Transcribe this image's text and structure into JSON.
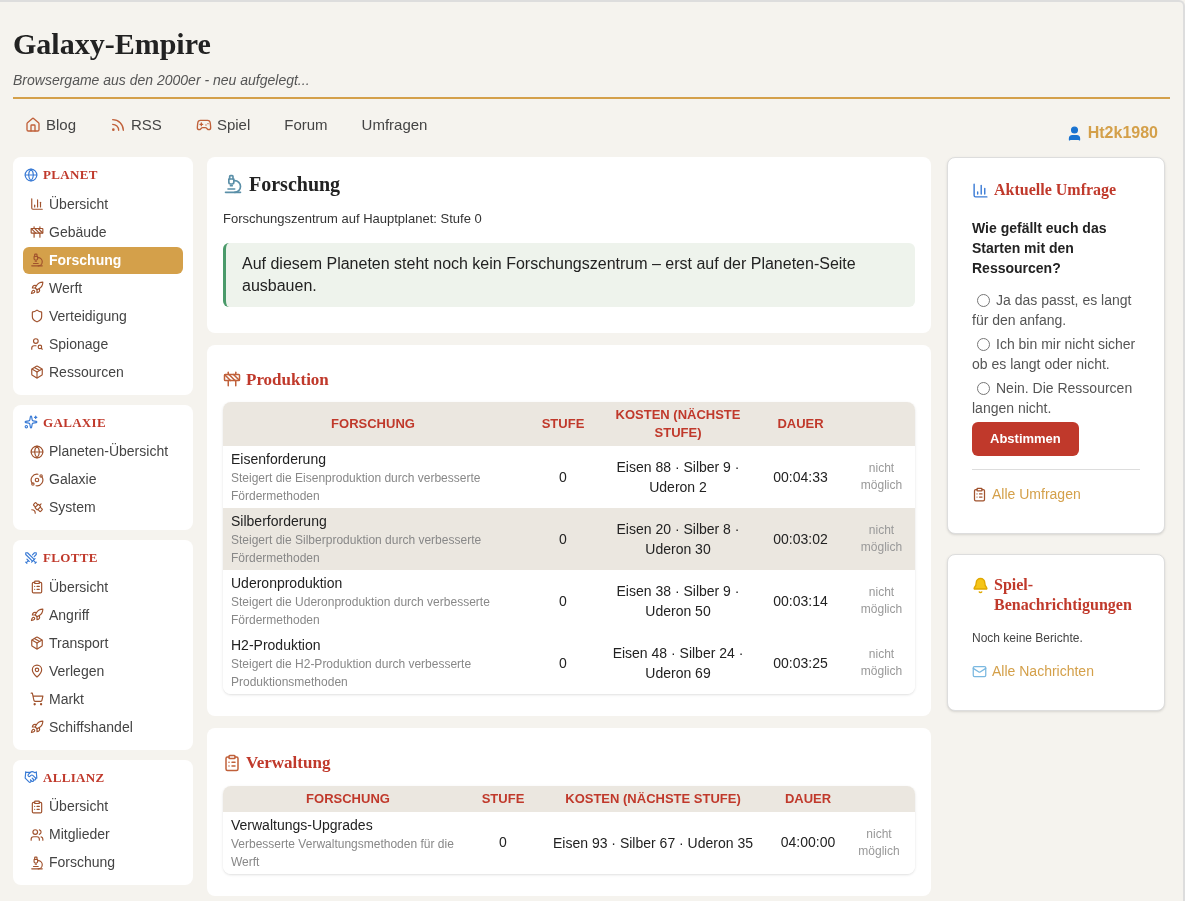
{
  "header": {
    "title": "Galaxy-Empire",
    "subtitle": "Browsergame aus den 2000er - neu aufgelegt..."
  },
  "nav": [
    {
      "label": "Blog",
      "kind": "home"
    },
    {
      "label": "RSS",
      "kind": "rss"
    },
    {
      "label": "Spiel",
      "kind": "game"
    },
    {
      "label": "Forum",
      "kind": "plain"
    },
    {
      "label": "Umfragen",
      "kind": "plain"
    }
  ],
  "user": {
    "name": "Ht2k1980"
  },
  "sidebar": [
    {
      "title": "PLANET",
      "items": [
        {
          "label": "Übersicht",
          "selected": false
        },
        {
          "label": "Gebäude",
          "selected": false
        },
        {
          "label": "Forschung",
          "selected": true
        },
        {
          "label": "Werft",
          "selected": false
        },
        {
          "label": "Verteidigung",
          "selected": false
        },
        {
          "label": "Spionage",
          "selected": false
        },
        {
          "label": "Ressourcen",
          "selected": false
        }
      ]
    },
    {
      "title": "GALAXIE",
      "items": [
        {
          "label": "Planeten-Übersicht",
          "selected": false
        },
        {
          "label": "Galaxie",
          "selected": false
        },
        {
          "label": "System",
          "selected": false
        }
      ]
    },
    {
      "title": "FLOTTE",
      "items": [
        {
          "label": "Übersicht",
          "selected": false
        },
        {
          "label": "Angriff",
          "selected": false
        },
        {
          "label": "Transport",
          "selected": false
        },
        {
          "label": "Verlegen",
          "selected": false
        },
        {
          "label": "Markt",
          "selected": false
        },
        {
          "label": "Schiffshandel",
          "selected": false
        }
      ]
    },
    {
      "title": "ALLIANZ",
      "items": [
        {
          "label": "Übersicht",
          "selected": false
        },
        {
          "label": "Mitglieder",
          "selected": false
        },
        {
          "label": "Forschung",
          "selected": false
        }
      ]
    }
  ],
  "main": {
    "title": "Forschung",
    "info": "Forschungszentrum auf Hauptplanet: Stufe 0",
    "notice": "Auf diesem Planeten steht noch kein Forschungszentrum – erst auf der Planeten-Seite ausbauen."
  },
  "sections": [
    {
      "title": "Produktion",
      "columns": [
        "FORSCHUNG",
        "STUFE",
        "KOSTEN (NÄCHSTE STUFE)",
        "DAUER"
      ],
      "rows": [
        {
          "name": "Eisenforderung",
          "description": "Steigert die Eisenproduktion durch verbesserte Fördermethoden",
          "level": "0",
          "cost": "Eisen 88 · Silber 9 · Uderon 2",
          "duration": "00:04:33",
          "action": "nicht möglich",
          "selected": false
        },
        {
          "name": "Silberforderung",
          "description": "Steigert die Silberproduktion durch verbesserte Fördermethoden",
          "level": "0",
          "cost": "Eisen 20 · Silber 8 · Uderon 30",
          "duration": "00:03:02",
          "action": "nicht möglich",
          "selected": true
        },
        {
          "name": "Uderonproduktion",
          "description": "Steigert die Uderonproduktion durch verbesserte Fördermethoden",
          "level": "0",
          "cost": "Eisen 38 · Silber 9 · Uderon 50",
          "duration": "00:03:14",
          "action": "nicht möglich",
          "selected": false
        },
        {
          "name": "H2-Produktion",
          "description": "Steigert die H2-Produktion durch verbesserte Produktionsmethoden",
          "level": "0",
          "cost": "Eisen 48 · Silber 24 · Uderon 69",
          "duration": "00:03:25",
          "action": "nicht möglich",
          "selected": false
        }
      ]
    },
    {
      "title": "Verwaltung",
      "columns": [
        "FORSCHUNG",
        "STUFE",
        "KOSTEN (NÄCHSTE STUFE)",
        "DAUER"
      ],
      "rows": [
        {
          "name": "Verwaltungs-Upgrades",
          "description": "Verbesserte Verwaltungsmethoden für die Werft",
          "level": "0",
          "cost": "Eisen 93 · Silber 67 · Uderon 35",
          "duration": "04:00:00",
          "action": "nicht möglich",
          "selected": false
        }
      ]
    }
  ],
  "poll": {
    "title": "Aktuelle Umfrage",
    "question": "Wie gefällt euch das Starten mit den Ressourcen?",
    "options": [
      {
        "label": "Ja das passt, es langt für den anfang.",
        "selected": false
      },
      {
        "label": "Ich bin mir nicht sicher ob es langt oder nicht.",
        "selected": false
      },
      {
        "label": "Nein. Die Ressourcen langen nicht.",
        "selected": false
      }
    ],
    "button": "Abstimmen",
    "link": "Alle Umfragen"
  },
  "notifications": {
    "title": "Spiel-Benachrichtigungen",
    "text": "Noch keine Berichte.",
    "link": "Alle Nachrichten"
  }
}
